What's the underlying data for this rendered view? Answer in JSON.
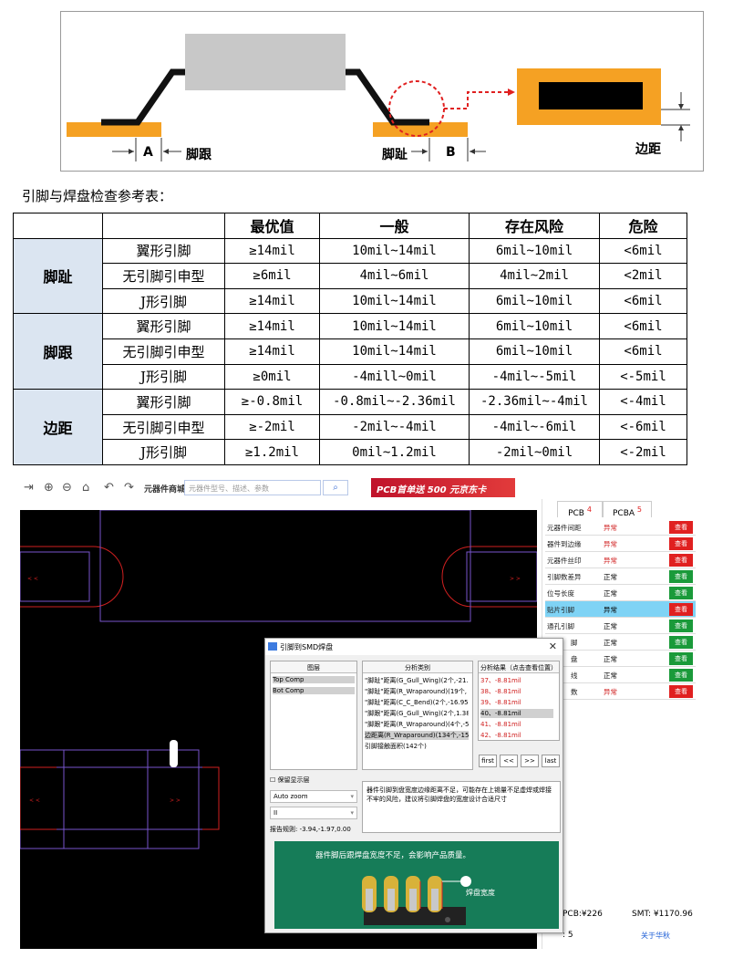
{
  "diagram": {
    "label_a": "A",
    "label_heel": "脚跟",
    "label_toe": "脚趾",
    "label_b": "B",
    "label_edge": "边距"
  },
  "caption": "引脚与焊盘检查参考表：",
  "table": {
    "headers": [
      "",
      "",
      "最优值",
      "一般",
      "存在风险",
      "危险"
    ],
    "groups": [
      {
        "name": "脚趾",
        "rows": [
          {
            "type": "翼形引脚",
            "best": "≥14mil",
            "normal": "10mil~14mil",
            "risk": "6mil~10mil",
            "danger": "<6mil"
          },
          {
            "type": "无引脚引申型",
            "best": "≥6mil",
            "normal": "4mil~6mil",
            "risk": "4mil~2mil",
            "danger": "<2mil"
          },
          {
            "type": "J形引脚",
            "best": "≥14mil",
            "normal": "10mil~14mil",
            "risk": "6mil~10mil",
            "danger": "<6mil"
          }
        ]
      },
      {
        "name": "脚跟",
        "rows": [
          {
            "type": "翼形引脚",
            "best": "≥14mil",
            "normal": "10mil~14mil",
            "risk": "6mil~10mil",
            "danger": "<6mil"
          },
          {
            "type": "无引脚引申型",
            "best": "≥14mil",
            "normal": "10mil~14mil",
            "risk": "6mil~10mil",
            "danger": "<6mil"
          },
          {
            "type": "J形引脚",
            "best": "≥0mil",
            "normal": "-4mill~0mil",
            "risk": "-4mil~-5mil",
            "danger": "<-5mil"
          }
        ]
      },
      {
        "name": "边距",
        "rows": [
          {
            "type": "翼形引脚",
            "best": "≥-0.8mil",
            "normal": "-0.8mil~-2.36mil",
            "risk": "-2.36mil~-4mil",
            "danger": "<-4mil"
          },
          {
            "type": "无引脚引申型",
            "best": "≥-2mil",
            "normal": "-2mil~-4mil",
            "risk": "-4mil~-6mil",
            "danger": "<-6mil"
          },
          {
            "type": "J形引脚",
            "best": "≥1.2mil",
            "normal": "0mil~1.2mil",
            "risk": "-2mil~0mil",
            "danger": "<-2mil"
          }
        ]
      }
    ]
  },
  "app": {
    "toolbar": {
      "mall_label": "元器件商城",
      "search_placeholder": "元器件型号、描述、参数",
      "ad_text": "PCB首单送 500 元京东卡"
    },
    "tabs": [
      {
        "label": "PCB",
        "count": "4"
      },
      {
        "label": "PCBA",
        "count": "5"
      }
    ],
    "checks": [
      {
        "name": "元器件间距",
        "status": "异常",
        "button": "查看",
        "ok": false
      },
      {
        "name": "器件到边缘",
        "status": "异常",
        "button": "查看",
        "ok": false
      },
      {
        "name": "元器件丝印",
        "status": "异常",
        "button": "查看",
        "ok": false
      },
      {
        "name": "引脚数差异",
        "status": "正常",
        "button": "查看",
        "ok": true
      },
      {
        "name": "位号长度",
        "status": "正常",
        "button": "查看",
        "ok": true
      },
      {
        "name": "贴片引脚",
        "status": "异常",
        "button": "查看",
        "ok": false
      },
      {
        "name": "通孔引脚",
        "status": "正常",
        "button": "查看",
        "ok": true
      },
      {
        "name": "脚",
        "status": "正常",
        "button": "查看",
        "ok": true
      },
      {
        "name": "盘",
        "status": "正常",
        "button": "查看",
        "ok": true
      },
      {
        "name": "线",
        "status": "正常",
        "button": "查看",
        "ok": true
      },
      {
        "name": "数",
        "status": "异常",
        "button": "查看",
        "ok": false
      }
    ],
    "price_pcb": "PCB:¥226",
    "price_smt": "SMT: ¥1170.96",
    "bottom_num": ": 5",
    "bottom_link": "关于华秋",
    "dialog": {
      "title": "引脚到SMD焊盘",
      "layer_header": "图层",
      "layers": [
        "Top Comp",
        "Bot Comp"
      ],
      "category_header": "分析类别",
      "categories": [
        "\"脚趾\"距离(G_Gull_Wing)(2个,-21.9",
        "\"脚趾\"距离(R_Wraparound)(19个,",
        "\"脚趾\"距离(C_C_Bend)(2个,-16.95r",
        "\"脚跟\"距离(G_Gull_Wing)(2个,1.38",
        "\"脚跟\"距离(R_Wraparound)(4个,-5",
        "边距离(R_Wraparound)(134个,-15",
        "引脚接触面积(142个)"
      ],
      "result_header": "分析结果（点击查看位置）",
      "results": [
        "37、-8.81mil",
        "38、-8.81mil",
        "39、-8.81mil",
        "40、-8.81mil",
        "41、-8.81mil",
        "42、-8.81mil"
      ],
      "nav": [
        "first",
        "<<",
        ">>",
        "last"
      ],
      "keep_layer": "保留显示层",
      "zoom": "Auto zoom",
      "mode": "II",
      "rule": "报告规则: -3.94,-1.97,0.00",
      "note": "器件引脚到盘宽度边缘距离不足，可能存在上锡量不足虚焊或焊接不牢的风险，建议将引脚焊盘的宽度设计合适尺寸",
      "image_text": "器件脚后跟焊盘宽度不足，会影响产品质量。",
      "image_label": "焊盘宽度"
    }
  }
}
